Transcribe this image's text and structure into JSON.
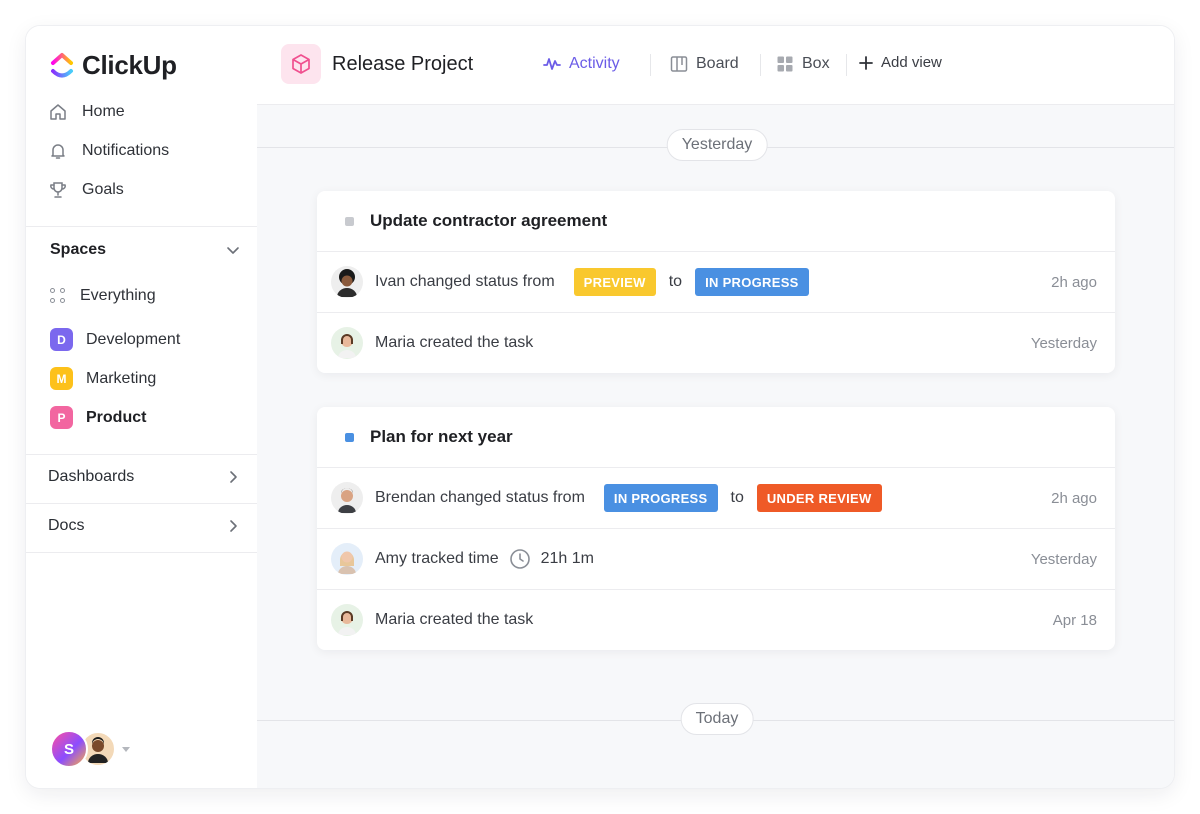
{
  "brand": {
    "name": "ClickUp"
  },
  "sidebar": {
    "nav": [
      {
        "label": "Home",
        "icon": "home-icon"
      },
      {
        "label": "Notifications",
        "icon": "bell-icon"
      },
      {
        "label": "Goals",
        "icon": "trophy-icon"
      }
    ],
    "spaces_label": "Spaces",
    "everything_label": "Everything",
    "spaces": [
      {
        "letter": "D",
        "label": "Development",
        "color": "#7b68ee"
      },
      {
        "letter": "M",
        "label": "Marketing",
        "color": "#fdc11a"
      },
      {
        "letter": "P",
        "label": "Product",
        "color": "#f266a0"
      }
    ],
    "dashboards_label": "Dashboards",
    "docs_label": "Docs",
    "user_initial": "S"
  },
  "header": {
    "project_title": "Release Project",
    "tabs": [
      {
        "label": "Activity",
        "icon": "activity-icon",
        "active": true
      },
      {
        "label": "Board",
        "icon": "board-icon",
        "active": false
      },
      {
        "label": "Box",
        "icon": "box-icon",
        "active": false
      }
    ],
    "add_view_label": "Add view"
  },
  "main": {
    "yesterday_label": "Yesterday",
    "today_label": "Today",
    "cards": [
      {
        "title": "Update contractor agreement",
        "marker_color": "#c8cacf",
        "rows": [
          {
            "text": "Ivan changed status from",
            "from": "PREVIEW",
            "to_word": "to",
            "to": "IN PROGRESS",
            "time": "2h ago"
          },
          {
            "text": "Maria created the task",
            "time": "Yesterday"
          }
        ]
      },
      {
        "title": "Plan for next year",
        "marker_color": "#4a90e2",
        "rows": [
          {
            "text": "Brendan changed status from",
            "from": "IN PROGRESS",
            "to_word": "to",
            "to": "UNDER REVIEW",
            "time": "2h ago"
          },
          {
            "text": "Amy tracked time",
            "duration": "21h 1m",
            "time": "Yesterday"
          },
          {
            "text": "Maria created the task",
            "time": "Apr 18"
          }
        ]
      }
    ]
  },
  "colors": {
    "preview": "#f9c82e",
    "in_progress": "#4a90e2",
    "under_review": "#ef5a27",
    "accent": "#6b5ce7"
  }
}
